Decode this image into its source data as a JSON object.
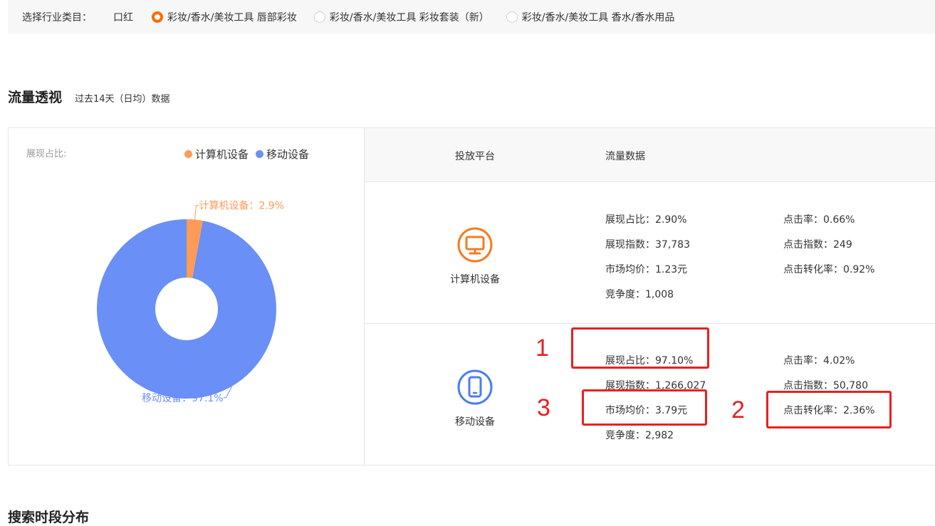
{
  "industry": {
    "label": "选择行业类目：",
    "options": [
      {
        "label": "口红",
        "radio": false,
        "selected": false
      },
      {
        "label": "彩妆/香水/美妆工具 唇部彩妆",
        "radio": true,
        "selected": true
      },
      {
        "label": "彩妆/香水/美妆工具 彩妆套装（新）",
        "radio": true,
        "selected": false
      },
      {
        "label": "彩妆/香水/美妆工具 香水/香水用品",
        "radio": true,
        "selected": false
      }
    ]
  },
  "traffic": {
    "title": "流量透视",
    "subtitle": "过去14天（日均）数据"
  },
  "pie": {
    "caption": "展现占比:",
    "legend": [
      {
        "label": "计算机设备",
        "color": "#ff9a57"
      },
      {
        "label": "移动设备",
        "color": "#6a8ff7"
      }
    ]
  },
  "chart_data": {
    "type": "pie",
    "donut": true,
    "series": [
      {
        "name": "计算机设备",
        "value": 2.9,
        "label": "计算机设备：2.9%",
        "color": "#ff9a57"
      },
      {
        "name": "移动设备",
        "value": 97.1,
        "label": "移动设备：97.1%",
        "color": "#6a8ff7"
      }
    ],
    "legend_position": "top-right"
  },
  "table": {
    "col1": "投放平台",
    "col2": "流量数据",
    "rows": [
      {
        "platform": "计算机设备",
        "icon": "desktop-icon",
        "color": "#f57b1f",
        "metrics": {
          "show_share": "展现占比：2.90%",
          "ctr": "点击率：0.66%",
          "show_index": "展现指数：37,783",
          "click_index": "点击指数：249",
          "avg_price": "市场均价：1.23元",
          "cvr": "点击转化率：0.92%",
          "competition": "竞争度：1,008"
        }
      },
      {
        "platform": "移动设备",
        "icon": "mobile-icon",
        "color": "#4b7df2",
        "metrics": {
          "show_share": "展现占比：97.10%",
          "ctr": "点击率：4.02%",
          "show_index": "展现指数：1,266,027",
          "click_index": "点击指数：50,780",
          "avg_price": "市场均价：3.79元",
          "cvr": "点击转化率：2.36%",
          "competition": "竞争度：2,982"
        }
      }
    ]
  },
  "annotations": {
    "n1": "1",
    "n2": "2",
    "n3": "3",
    "color": "#e8201f"
  },
  "search_period": {
    "title": "搜索时段分布"
  }
}
